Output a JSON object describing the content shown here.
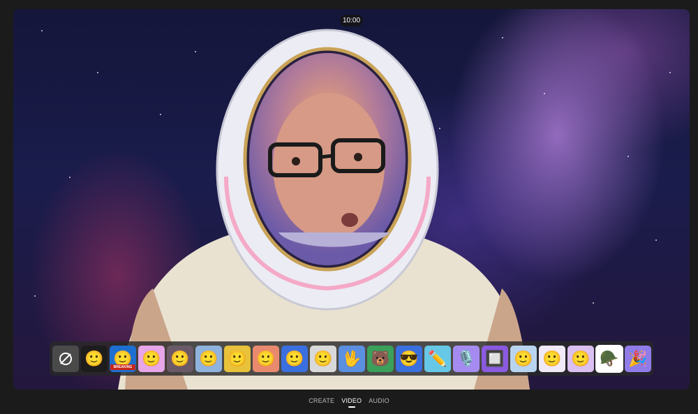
{
  "camera": {
    "time": "10:00"
  },
  "effects": {
    "tiles": [
      {
        "name": "no-effect-icon",
        "bg": "#4a4a4a",
        "glyph": "",
        "selected": false
      },
      {
        "name": "smiley-dark-icon",
        "bg": "#1d1d1d",
        "glyph": "🙂",
        "selected": false
      },
      {
        "name": "breaking-news-icon",
        "bg": "#1d6fd0",
        "glyph": "🙂",
        "caption": "BREAKING",
        "selected": false
      },
      {
        "name": "smiley-pink-icon",
        "bg": "#e6a6e8",
        "glyph": "🙂",
        "selected": false
      },
      {
        "name": "smiley-burst-icon",
        "bg": "#6a5a68",
        "glyph": "🙂",
        "selected": false
      },
      {
        "name": "smiley-sketch-icon",
        "bg": "#8fb3dd",
        "glyph": "🙂",
        "selected": false
      },
      {
        "name": "smiley-yellow-icon",
        "bg": "#e7c23a",
        "glyph": "🙂",
        "selected": false
      },
      {
        "name": "smiley-glow-icon",
        "bg": "#e98a6f",
        "glyph": "🙂",
        "selected": false
      },
      {
        "name": "smiley-rainbow-icon",
        "bg": "#3a6fe0",
        "glyph": "🙂",
        "selected": false
      },
      {
        "name": "smiley-mono-icon",
        "bg": "#d9d9d9",
        "glyph": "🙂",
        "selected": false
      },
      {
        "name": "hand-gesture-icon",
        "bg": "#5b8fe0",
        "glyph": "🖖",
        "selected": false
      },
      {
        "name": "bear-face-icon",
        "bg": "#3aa05a",
        "glyph": "🐻",
        "selected": false
      },
      {
        "name": "sunglasses-face-icon",
        "bg": "#3a6fe0",
        "glyph": "😎",
        "selected": false
      },
      {
        "name": "pencil-icon",
        "bg": "#67c7e6",
        "glyph": "✏️",
        "selected": false
      },
      {
        "name": "microphone-icon",
        "bg": "#a58bf0",
        "glyph": "🎙️",
        "selected": false
      },
      {
        "name": "frame-lights-icon",
        "bg": "#8a5ae0",
        "glyph": "🔲",
        "selected": false
      },
      {
        "name": "smiley-swirl-icon",
        "bg": "#b8d4f0",
        "glyph": "🙂",
        "selected": false
      },
      {
        "name": "smiley-light-icon",
        "bg": "#f0eaf8",
        "glyph": "🙂",
        "selected": false
      },
      {
        "name": "smiley-lavender-icon",
        "bg": "#d9c0f0",
        "glyph": "🙂",
        "selected": false
      },
      {
        "name": "astronaut-helmet-icon",
        "bg": "#ffffff",
        "glyph": "🪖",
        "selected": true
      },
      {
        "name": "party-hat-icon",
        "bg": "#8f7ce8",
        "glyph": "🎉",
        "selected": false
      }
    ]
  },
  "modes": {
    "create": "CREATE",
    "video": "VIDEO",
    "audio": "AUDIO"
  },
  "colors": {
    "accent": "#ffffff",
    "tray_bg": "#282828",
    "page_bg": "#1b1b1b"
  }
}
